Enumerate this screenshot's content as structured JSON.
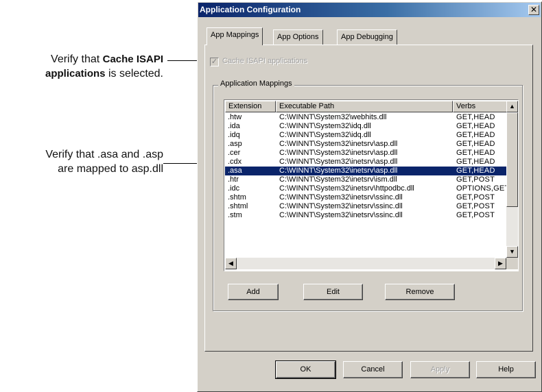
{
  "callouts": {
    "cache": {
      "prefix": "Verify that ",
      "bold1": "Cache ISAPI",
      "bold2": "applications",
      "suffix": " is selected."
    },
    "mapping": {
      "line1": "Verify that .asa and .asp",
      "line2": "are mapped to asp.dll"
    }
  },
  "dialog": {
    "title": "Application Configuration",
    "close_glyph": "✕",
    "tabs": [
      "App Mappings",
      "App Options",
      "App Debugging"
    ],
    "cache_checkbox": {
      "label": "Cache ISAPI applications",
      "checked": true,
      "check_glyph": "✓"
    },
    "group_title": "Application Mappings",
    "list": {
      "columns": [
        "Extension",
        "Executable Path",
        "Verbs"
      ],
      "rows": [
        {
          "ext": ".htw",
          "path": "C:\\WINNT\\System32\\webhits.dll",
          "verbs": "GET,HEAD"
        },
        {
          "ext": ".ida",
          "path": "C:\\WINNT\\System32\\idq.dll",
          "verbs": "GET,HEAD"
        },
        {
          "ext": ".idq",
          "path": "C:\\WINNT\\System32\\idq.dll",
          "verbs": "GET,HEAD"
        },
        {
          "ext": ".asp",
          "path": "C:\\WINNT\\System32\\inetsrv\\asp.dll",
          "verbs": "GET,HEAD"
        },
        {
          "ext": ".cer",
          "path": "C:\\WINNT\\System32\\inetsrv\\asp.dll",
          "verbs": "GET,HEAD"
        },
        {
          "ext": ".cdx",
          "path": "C:\\WINNT\\System32\\inetsrv\\asp.dll",
          "verbs": "GET,HEAD"
        },
        {
          "ext": ".asa",
          "path": "C:\\WINNT\\System32\\inetsrv\\asp.dll",
          "verbs": "GET,HEAD"
        },
        {
          "ext": ".htr",
          "path": "C:\\WINNT\\System32\\inetsrv\\ism.dll",
          "verbs": "GET,POST"
        },
        {
          "ext": ".idc",
          "path": "C:\\WINNT\\System32\\inetsrv\\httpodbc.dll",
          "verbs": "OPTIONS,GET"
        },
        {
          "ext": ".shtm",
          "path": "C:\\WINNT\\System32\\inetsrv\\ssinc.dll",
          "verbs": "GET,POST"
        },
        {
          "ext": ".shtml",
          "path": "C:\\WINNT\\System32\\inetsrv\\ssinc.dll",
          "verbs": "GET,POST"
        },
        {
          "ext": ".stm",
          "path": "C:\\WINNT\\System32\\inetsrv\\ssinc.dll",
          "verbs": "GET,POST"
        }
      ],
      "selected_index": 6,
      "scroll_glyphs": {
        "up": "▲",
        "down": "▼",
        "left": "◀",
        "right": "▶"
      }
    },
    "buttons": {
      "add": "Add",
      "edit": "Edit",
      "remove": "Remove",
      "ok": "OK",
      "cancel": "Cancel",
      "apply": "Apply",
      "help": "Help"
    }
  },
  "colors": {
    "selection": "#0a246a",
    "face": "#d4d0c8",
    "title_start": "#0a246a",
    "title_end": "#a6caf0"
  }
}
